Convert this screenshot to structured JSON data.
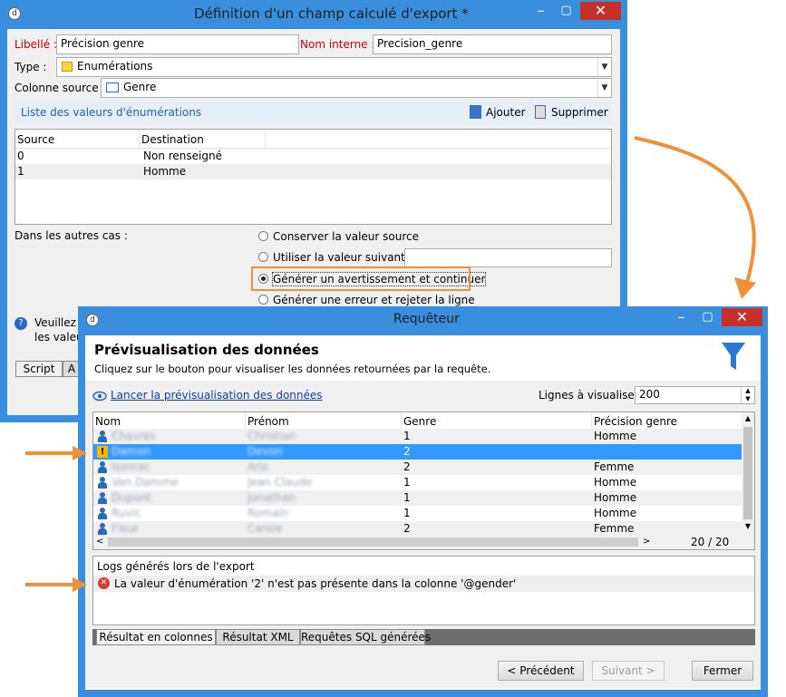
{
  "colors": {
    "window_frame": "#3a8ede",
    "close": "#c7302a",
    "selection": "#3399ff",
    "callout": "#f0913a",
    "error": "#d23c3c"
  },
  "win1": {
    "title": "Définition d'un champ calculé d'export *",
    "label_label": "Libellé :",
    "label_value": "Précision genre",
    "internal_name_label": "Nom interne :",
    "internal_name_value": "Precision_genre",
    "type_label": "Type :",
    "type_value": "Enumérations",
    "source_col_label": "Colonne source :",
    "source_col_value": "Genre",
    "enum_list_title": "Liste des valeurs d'énumérations",
    "add_label": "Ajouter",
    "delete_label": "Supprimer",
    "table_headers": [
      "Source",
      "Destination"
    ],
    "table_rows": [
      {
        "source": "0",
        "destination": "Non renseigné"
      },
      {
        "source": "1",
        "destination": "Homme"
      }
    ],
    "other_cases_label": "Dans les autres cas :",
    "options": [
      "Conserver la valeur source",
      "Utiliser la valeur suivante :",
      "Générer un avertissement et continuer",
      "Générer une erreur et rejeter la ligne"
    ],
    "selected_option": 2,
    "help_line1": "Veuillez r",
    "help_line2": "les valeur",
    "tab_script": "Script",
    "tab_next": "A"
  },
  "win2": {
    "title": "Requêteur",
    "heading": "Prévisualisation des données",
    "subheading": "Cliquez sur le bouton pour visualiser les données retournées par la requête.",
    "launch_link": "Lancer la prévisualisation des données",
    "lines_label": "Lignes à visualiser :",
    "lines_value": "200",
    "columns": [
      "Nom",
      "Prénom",
      "Genre",
      "Précision genre"
    ],
    "rows": [
      {
        "nom": "Chavres",
        "prenom": "Christian",
        "genre": "1",
        "precision": "Homme",
        "warn": false
      },
      {
        "nom": "Damon",
        "prenom": "Devon",
        "genre": "2",
        "precision": "",
        "warn": true
      },
      {
        "nom": "Isomac",
        "prenom": "Aris",
        "genre": "2",
        "precision": "Femme",
        "warn": false
      },
      {
        "nom": "Van Damme",
        "prenom": "Jean Claude",
        "genre": "1",
        "precision": "Homme",
        "warn": false
      },
      {
        "nom": "Dupont",
        "prenom": "Jonathan",
        "genre": "1",
        "precision": "Homme",
        "warn": false
      },
      {
        "nom": "Ruvic",
        "prenom": "Romain",
        "genre": "1",
        "precision": "Homme",
        "warn": false
      },
      {
        "nom": "Fleur",
        "prenom": "Carole",
        "genre": "2",
        "precision": "Femme",
        "warn": false
      }
    ],
    "page_counter": "20 / 20",
    "logs_title": "Logs générés lors de l'export",
    "log_message": "La valeur d'énumération '2' n'est pas présente dans la colonne '@gender'",
    "tabs": [
      "Résultat en colonnes",
      "Résultat XML",
      "Requêtes SQL générées"
    ],
    "prev_button": "< Précédent",
    "next_button": "Suivant >",
    "close_button": "Fermer"
  }
}
